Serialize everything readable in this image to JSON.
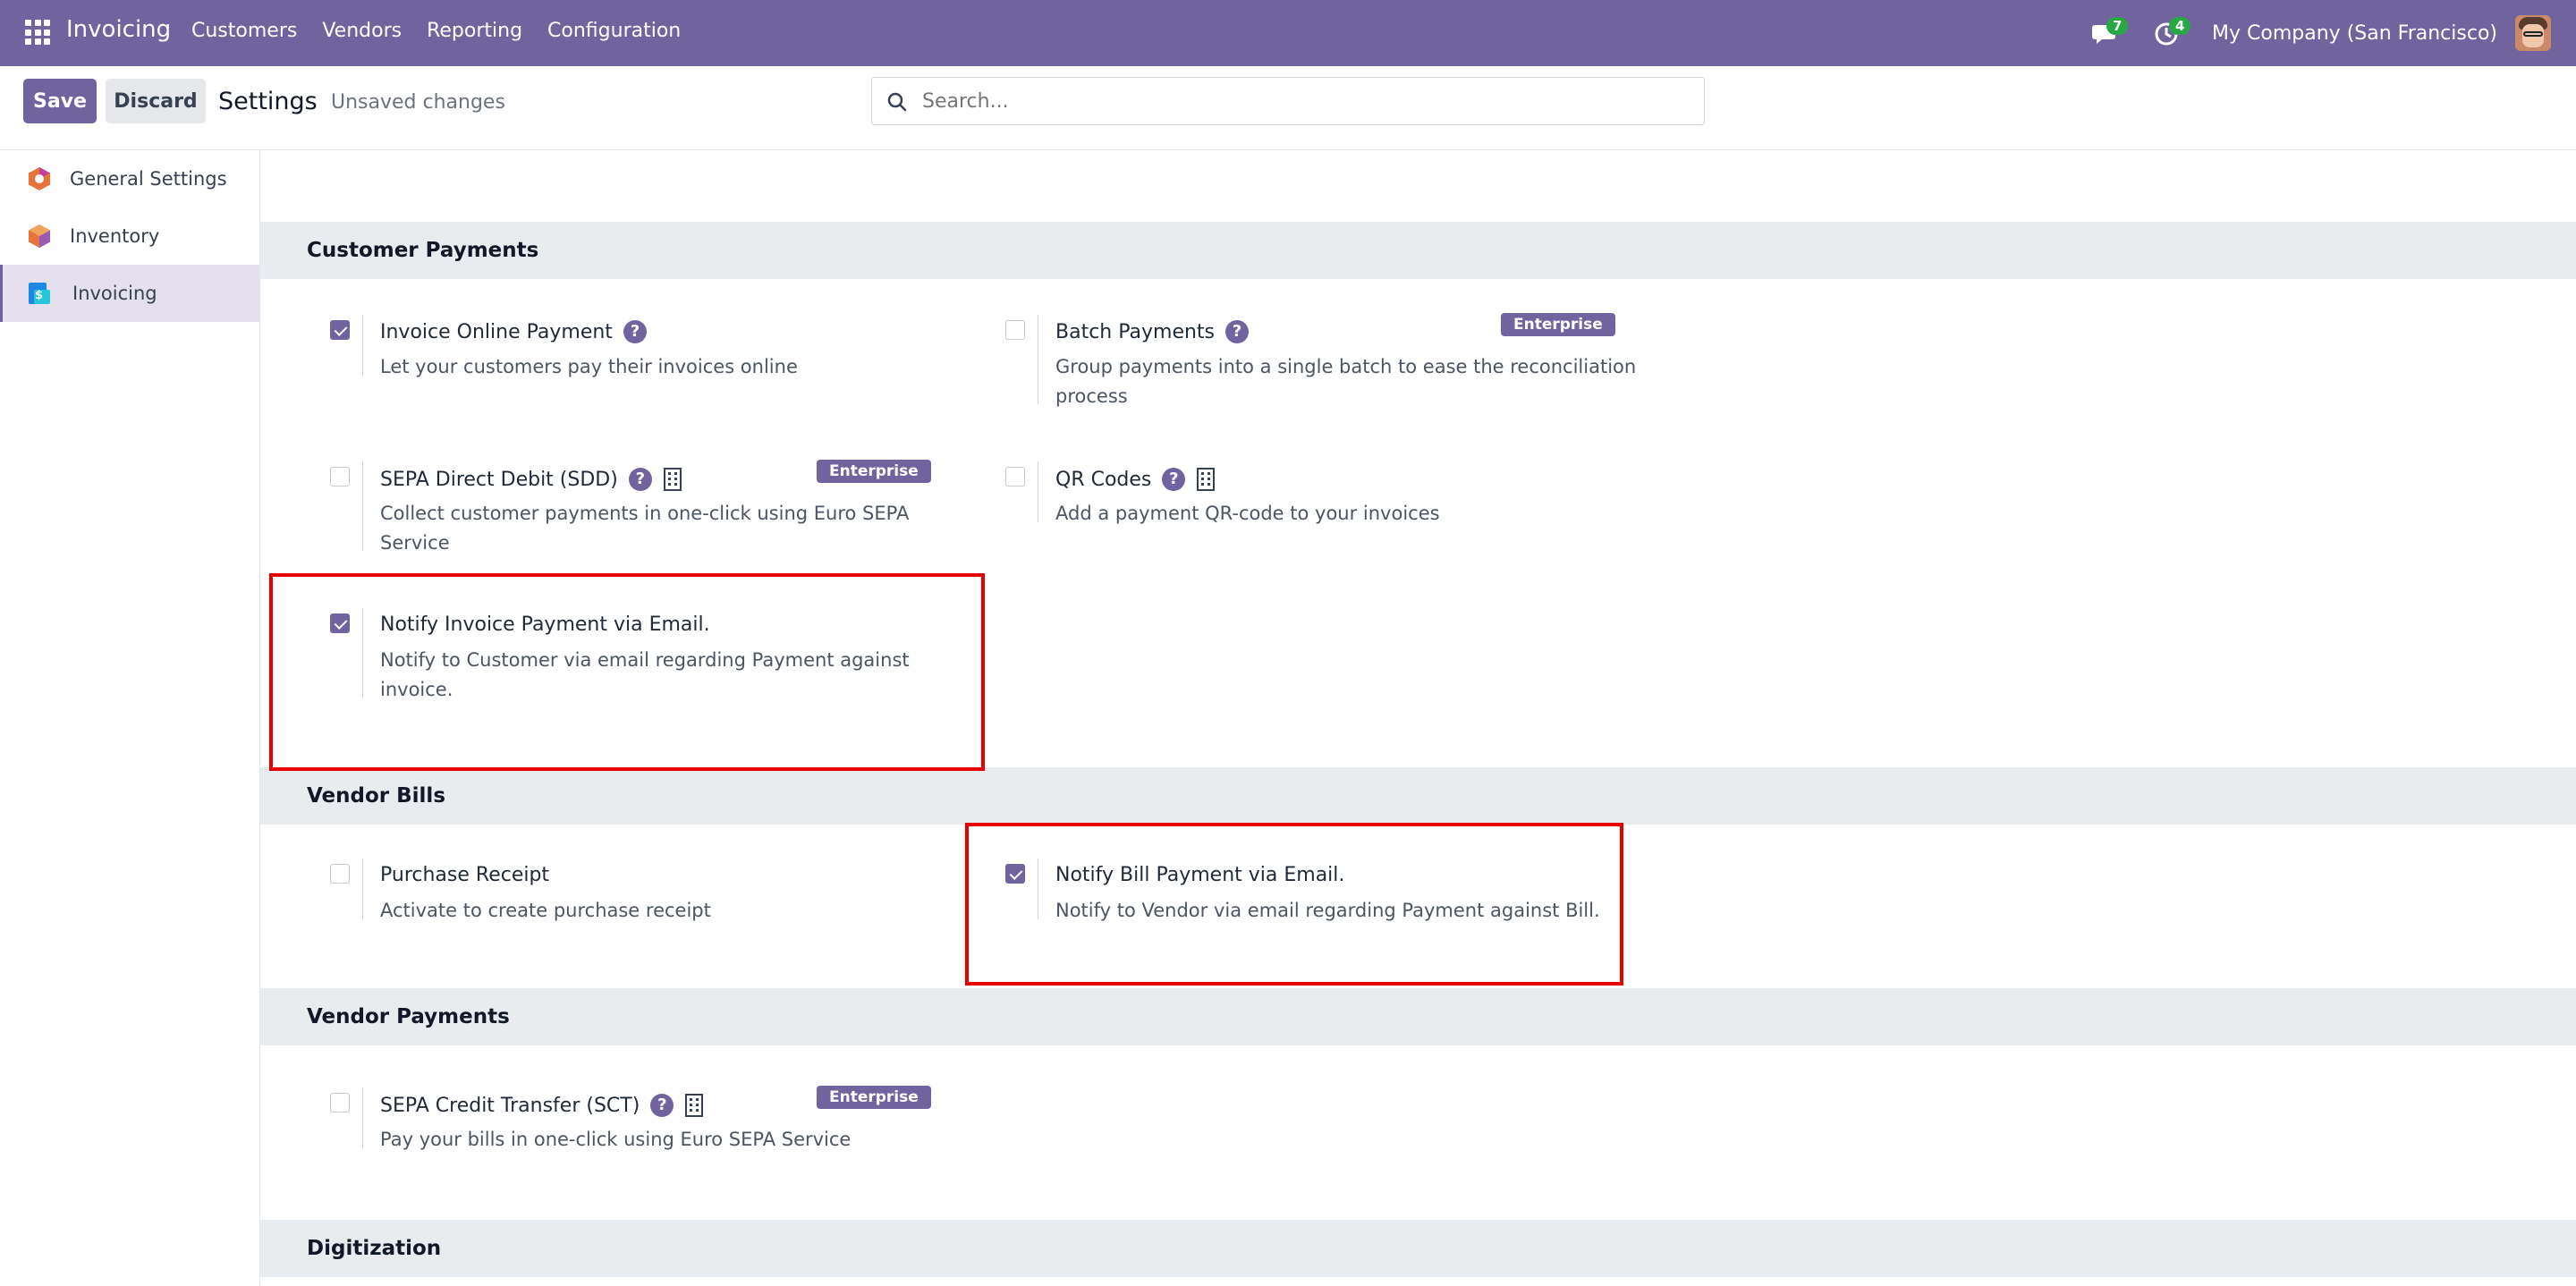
{
  "navbar": {
    "app_name": "Invoicing",
    "menu": [
      "Customers",
      "Vendors",
      "Reporting",
      "Configuration"
    ],
    "messages_count": "7",
    "activities_count": "4",
    "company": "My Company (San Francisco)"
  },
  "control": {
    "save_label": "Save",
    "discard_label": "Discard",
    "breadcrumb": "Settings",
    "status": "Unsaved changes",
    "search_placeholder": "Search..."
  },
  "sidebar": {
    "items": [
      {
        "label": "General Settings",
        "icon": "general-settings-icon"
      },
      {
        "label": "Inventory",
        "icon": "inventory-icon"
      },
      {
        "label": "Invoicing",
        "icon": "invoicing-icon",
        "active": true
      }
    ]
  },
  "sections": {
    "customer_payments": {
      "title": "Customer Payments",
      "settings": [
        {
          "title": "Invoice Online Payment",
          "desc": "Let your customers pay their invoices online",
          "checked": true
        },
        {
          "title": "Batch Payments",
          "desc": "Group payments into a single batch to ease the reconciliation process",
          "checked": false,
          "badge": "Enterprise"
        },
        {
          "title": "SEPA Direct Debit (SDD)",
          "desc": "Collect customer payments in one-click using Euro SEPA Service",
          "checked": false,
          "badge": "Enterprise"
        },
        {
          "title": "QR Codes",
          "desc": "Add a payment QR-code to your invoices",
          "checked": false
        },
        {
          "title": "Notify Invoice Payment via Email.",
          "desc": "Notify to Customer via email regarding Payment against invoice.",
          "checked": true
        }
      ]
    },
    "vendor_bills": {
      "title": "Vendor Bills",
      "settings": [
        {
          "title": "Purchase Receipt",
          "desc": "Activate to create purchase receipt",
          "checked": false
        },
        {
          "title": "Notify Bill Payment via Email.",
          "desc": "Notify to Vendor via email regarding Payment against Bill.",
          "checked": true
        }
      ]
    },
    "vendor_payments": {
      "title": "Vendor Payments",
      "settings": [
        {
          "title": "SEPA Credit Transfer (SCT)",
          "desc": "Pay your bills in one-click using Euro SEPA Service",
          "checked": false,
          "badge": "Enterprise"
        }
      ]
    },
    "digitization": {
      "title": "Digitization"
    }
  },
  "colors": {
    "brand": "#71639e",
    "badge_green": "#28a745",
    "highlight_red": "#e60000"
  }
}
